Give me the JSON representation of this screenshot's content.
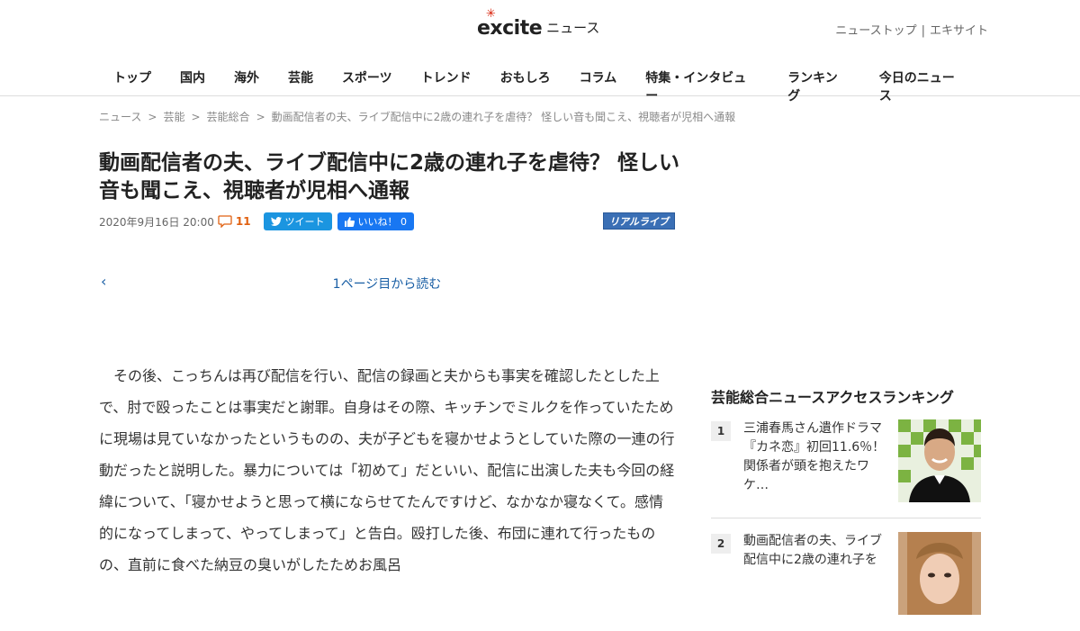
{
  "header": {
    "logo_text": "excite",
    "logo_suffix": "ニュース",
    "top_links": [
      "ニューストップ",
      "エキサイト"
    ],
    "top_links_sep": "|"
  },
  "nav": {
    "items": [
      "トップ",
      "国内",
      "海外",
      "芸能",
      "スポーツ",
      "トレンド",
      "おもしろ",
      "コラム",
      "特集・インタビュー",
      "ランキング",
      "今日のニュース"
    ]
  },
  "breadcrumb": {
    "items": [
      "ニュース",
      "芸能",
      "芸能総合",
      "動画配信者の夫、ライブ配信中に2歳の連れ子を虐待？ 怪しい音も聞こえ、視聴者が児相へ通報"
    ],
    "sep": ">"
  },
  "article": {
    "title": "動画配信者の夫、ライブ配信中に2歳の連れ子を虐待？ 怪しい音も聞こえ、視聴者が児相へ通報",
    "date": "2020年9月16日 20:00",
    "comment_count": "11",
    "tweet_label": "ツイート",
    "like_label": "いいね！ 0",
    "source_label": "リアルライブ",
    "pager_prev": "‹",
    "pager_link": "1ページ目から読む",
    "body": "その後、こっちんは再び配信を行い、配信の録画と夫からも事実を確認したとした上で、肘で殴ったことは事実だと謝罪。自身はその際、キッチンでミルクを作っていたために現場は見ていなかったというものの、夫が子どもを寝かせようとしていた際の一連の行動だったと説明した。暴力については「初めて」だといい、配信に出演した夫も今回の経緯について、「寝かせようと思って横にならせてたんですけど、なかなか寝なくて。感情的になってしまって、やってしまって」と告白。殴打した後、布団に連れて行ったものの、直前に食べた納豆の臭いがしたためお風呂"
  },
  "ranking": {
    "title": "芸能総合ニュースアクセスランキング",
    "items": [
      {
        "rank": "1",
        "text": "三浦春馬さん遺作ドラマ『カネ恋』初回11.6％！関係者が頭を抱えたワケ…"
      },
      {
        "rank": "2",
        "text": "動画配信者の夫、ライブ配信中に2歳の連れ子を"
      }
    ]
  },
  "colors": {
    "accent_link": "#1a5fa5",
    "logo_spark": "#d81e06",
    "comment": "#e06010",
    "tweet": "#1b95e0",
    "like": "#1877f2",
    "source_badge": "#3a6fb5"
  }
}
